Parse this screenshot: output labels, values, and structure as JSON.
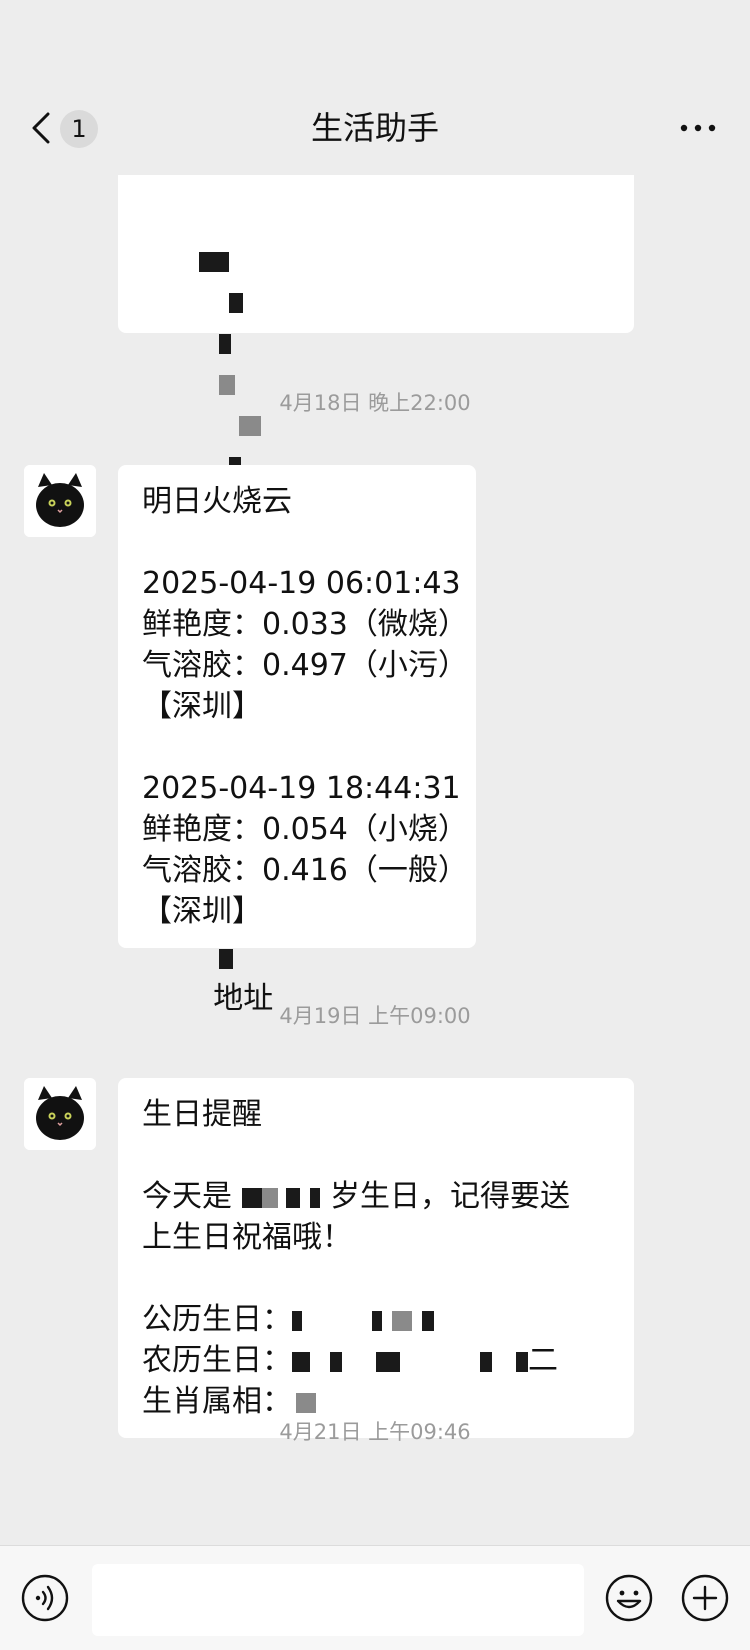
{
  "header": {
    "title": "生活助手",
    "unread_count": "1"
  },
  "messages": {
    "partial": {
      "line2_suffix": "地址"
    },
    "timestamp1": "4月18日 晚上22:00",
    "sunset": {
      "lines": [
        "明日火烧云",
        "",
        "2025-04-19 06:01:43",
        "鲜艳度：0.033（微烧）",
        "气溶胶：0.497（小污）",
        "【深圳】",
        "",
        "2025-04-19 18:44:31",
        "鲜艳度：0.054（小烧）",
        "气溶胶：0.416（一般）",
        "【深圳】"
      ]
    },
    "timestamp2": "4月19日 上午09:00",
    "birthday": {
      "title": "生日提醒",
      "line2_prefix": "今天是",
      "line2_suffix": "岁生日，记得要送",
      "line3": "上生日祝福哦！",
      "solar_label": "公历生日：",
      "lunar_label": "农历生日：",
      "lunar_suffix": "二",
      "zodiac_label": "生肖属相："
    },
    "timestamp3": "4月21日 上午09:46"
  },
  "input": {
    "placeholder": ""
  },
  "icons": {
    "back": "chevron-left-icon",
    "more": "more-dots-icon",
    "voice": "voice-icon",
    "emoji": "emoji-icon",
    "plus": "plus-icon",
    "avatar": "black-cat-avatar"
  }
}
